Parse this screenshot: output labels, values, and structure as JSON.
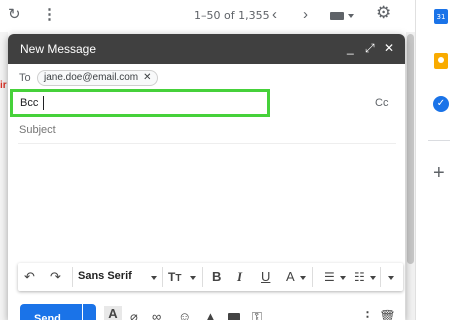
{
  "toolbar": {
    "pagination": "1–50 of 1,355",
    "icons": [
      "refresh-icon",
      "more-vert-icon",
      "chevron-left-icon",
      "chevron-right-icon",
      "keyboard-icon",
      "gear-icon"
    ]
  },
  "side_panel": {
    "calendar_day": "31",
    "icons": [
      "calendar-icon",
      "keep-icon",
      "tasks-icon",
      "add-icon"
    ]
  },
  "compose": {
    "title": "New Message",
    "to_label": "To",
    "recipient": "jane.doe@email.com",
    "bcc_label": "Bcc",
    "cc_label": "Cc",
    "subject_placeholder": "Subject",
    "highlight_color": "#46d13a"
  },
  "format_bar": {
    "font_family": "Sans Serif",
    "bold": "B",
    "italic": "I",
    "underline": "U",
    "text_color": "A"
  },
  "actions": {
    "send_label": "Send"
  },
  "colors": {
    "header_bg": "#404040",
    "send_bg": "#1a73e8"
  }
}
